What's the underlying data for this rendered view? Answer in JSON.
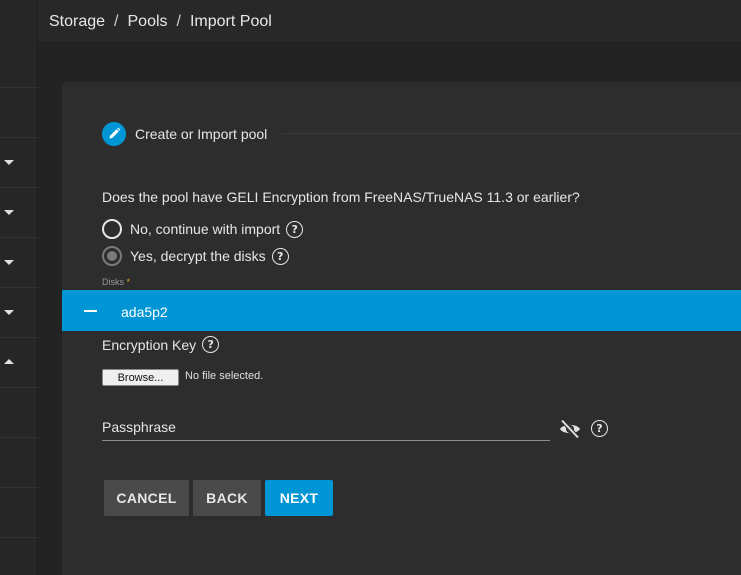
{
  "breadcrumb": {
    "items": [
      "Storage",
      "Pools",
      "Import Pool"
    ],
    "separator": "/"
  },
  "stepper": {
    "title": "Create or Import pool",
    "icon": "pencil-icon"
  },
  "form": {
    "question": "Does the pool have GELI Encryption from FreeNAS/TrueNAS 11.3 or earlier?",
    "options": [
      {
        "label": "No, continue with import",
        "selected": false
      },
      {
        "label": "Yes, decrypt the disks",
        "selected": true
      }
    ],
    "disks_label": "Disks",
    "disks_required": "*",
    "selected_disk": "ada5p2",
    "encryption_key_label": "Encryption Key",
    "browse_label": "Browse...",
    "no_file_text": "No file selected.",
    "passphrase_label": "Passphrase"
  },
  "buttons": {
    "cancel": "CANCEL",
    "back": "BACK",
    "next": "NEXT"
  },
  "colors": {
    "accent": "#0095d5",
    "background": "#232323",
    "card": "#2d2d2d"
  }
}
